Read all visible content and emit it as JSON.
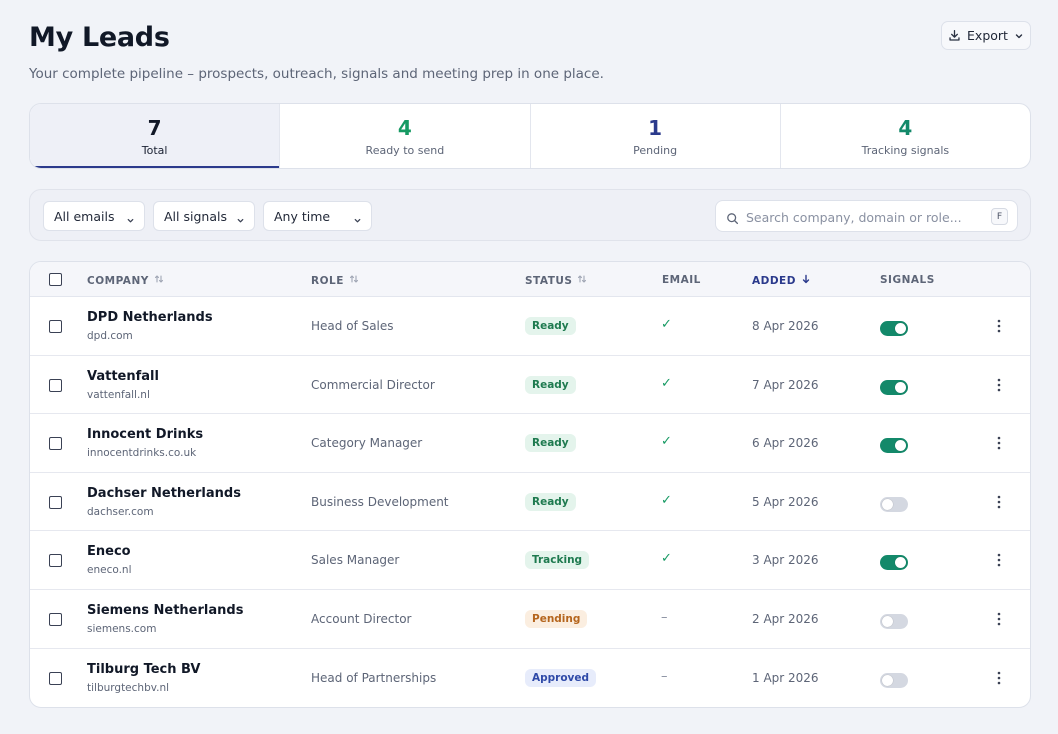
{
  "header": {
    "title": "My Leads",
    "subtitle": "Your complete pipeline – prospects, outreach, signals and meeting prep in one place.",
    "export_label": "Export"
  },
  "stats": [
    {
      "value": "7",
      "label": "Total",
      "color": "#111827",
      "active": true
    },
    {
      "value": "4",
      "label": "Ready to send",
      "color": "#169a63",
      "active": false
    },
    {
      "value": "1",
      "label": "Pending",
      "color": "#2b3a8c",
      "active": false
    },
    {
      "value": "4",
      "label": "Tracking signals",
      "color": "#13896a",
      "active": false
    }
  ],
  "filters": {
    "emails": "All emails",
    "signals": "All signals",
    "time": "Any time",
    "search_placeholder": "Search company, domain or role...",
    "search_shortcut": "F"
  },
  "table": {
    "columns": {
      "company": "COMPANY",
      "role": "ROLE",
      "status": "STATUS",
      "email": "EMAIL",
      "added": "ADDED",
      "signals": "SIGNALS"
    },
    "rows": [
      {
        "company": "DPD Netherlands",
        "domain": "dpd.com",
        "role": "Head of Sales",
        "status": "Ready",
        "status_type": "ready",
        "email": "✓",
        "added": "8 Apr 2026",
        "signals_on": true
      },
      {
        "company": "Vattenfall",
        "domain": "vattenfall.nl",
        "role": "Commercial Director",
        "status": "Ready",
        "status_type": "ready",
        "email": "✓",
        "added": "7 Apr 2026",
        "signals_on": true
      },
      {
        "company": "Innocent Drinks",
        "domain": "innocentdrinks.co.uk",
        "role": "Category Manager",
        "status": "Ready",
        "status_type": "ready",
        "email": "✓",
        "added": "6 Apr 2026",
        "signals_on": true
      },
      {
        "company": "Dachser Netherlands",
        "domain": "dachser.com",
        "role": "Business Development",
        "status": "Ready",
        "status_type": "ready",
        "email": "✓",
        "added": "5 Apr 2026",
        "signals_on": false
      },
      {
        "company": "Eneco",
        "domain": "eneco.nl",
        "role": "Sales Manager",
        "status": "Tracking",
        "status_type": "tracking",
        "email": "✓",
        "added": "3 Apr 2026",
        "signals_on": true
      },
      {
        "company": "Siemens Netherlands",
        "domain": "siemens.com",
        "role": "Account Director",
        "status": "Pending",
        "status_type": "pending",
        "email": "–",
        "added": "2 Apr 2026",
        "signals_on": false
      },
      {
        "company": "Tilburg Tech BV",
        "domain": "tilburgtechbv.nl",
        "role": "Head of Partnerships",
        "status": "Approved",
        "status_type": "approved",
        "email": "–",
        "added": "1 Apr 2026",
        "signals_on": false
      }
    ]
  }
}
